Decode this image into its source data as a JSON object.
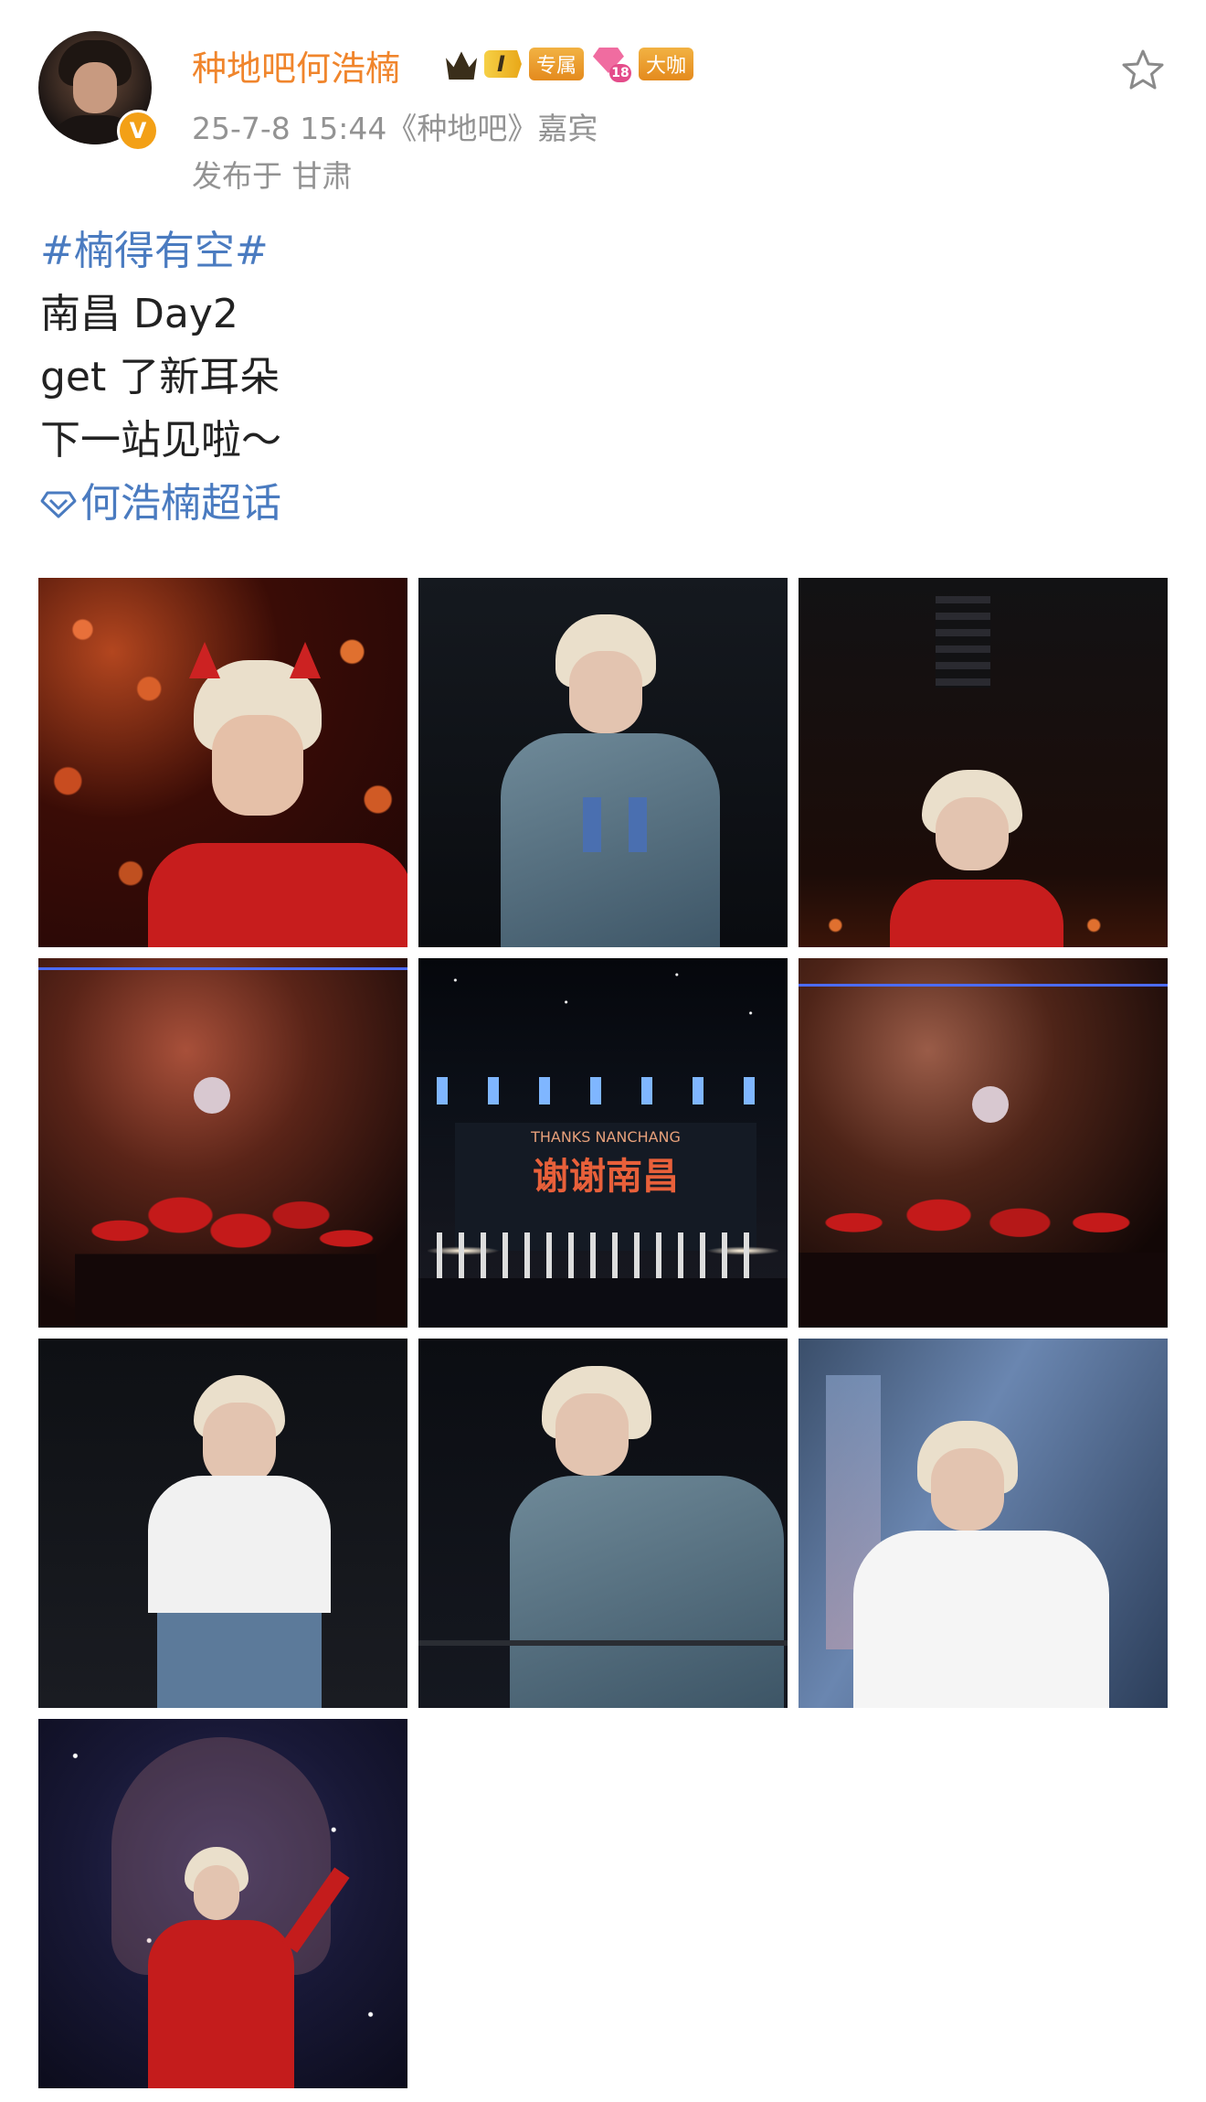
{
  "user": {
    "name": "种地吧何浩楠",
    "verified_badge": "V",
    "level_badge": "I",
    "tag_exclusive": "专属",
    "svip_level": "18",
    "tag_bigshot": "大咖"
  },
  "meta": {
    "time_source": "25-7-8 15:44《种地吧》嘉宾",
    "location": "发布于 甘肃"
  },
  "post": {
    "hashtag": "#楠得有空#",
    "lines": [
      "南昌 Day2",
      "get 了新耳朵",
      "下一站见啦～"
    ],
    "topic_link": "何浩楠超话"
  },
  "photos": {
    "banner_en": "THANKS NANCHANG",
    "banner_cn": "谢谢南昌"
  },
  "colors": {
    "username": "#f0852c",
    "link": "#4a7bc0",
    "meta": "#939393"
  },
  "icons": [
    "verified-icon",
    "crown-icon",
    "svip-icon",
    "star-icon",
    "super-topic-icon"
  ]
}
